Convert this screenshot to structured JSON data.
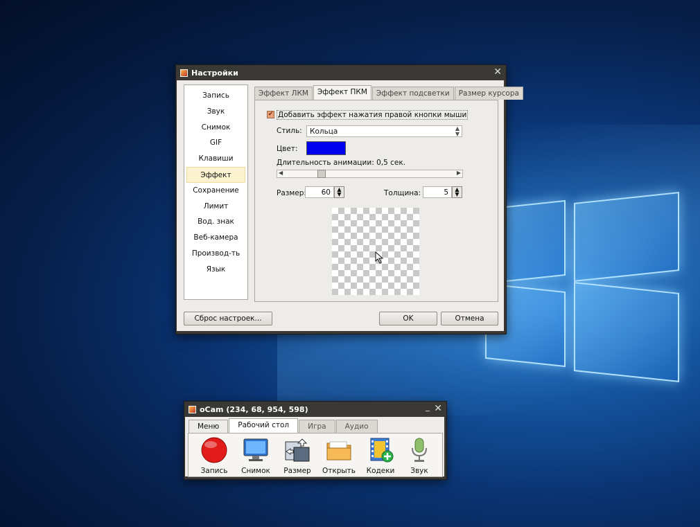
{
  "settings": {
    "title": "Настройки",
    "nav": [
      "Запись",
      "Звук",
      "Снимок",
      "GIF",
      "Клавиши",
      "Эффект",
      "Сохранение",
      "Лимит",
      "Вод. знак",
      "Веб-камера",
      "Производ-ть",
      "Язык"
    ],
    "active_nav": "Эффект",
    "tabs": [
      "Эффект ЛКМ",
      "Эффект ПКМ",
      "Эффект подсветки",
      "Размер курсора"
    ],
    "active_tab": "Эффект ПКМ",
    "enable_label": "Добавить эффект нажатия правой кнопки мыши",
    "enable_checked": true,
    "style_label": "Стиль:",
    "style_value": "Кольца",
    "color_label": "Цвет:",
    "color_value": "#0000ee",
    "duration_label": "Длительность анимации: 0,5 сек.",
    "duration_slider_fraction": 0.2,
    "size_label": "Размер:",
    "size_value": "60",
    "thickness_label": "Толщина:",
    "thickness_value": "5",
    "reset_button": "Сброс настроек...",
    "ok_button": "OK",
    "cancel_button": "Отмена"
  },
  "ocam": {
    "title": "oCam (234, 68, 954, 598)",
    "tabs": [
      "Меню",
      "Рабочий стол",
      "Игра",
      "Аудио"
    ],
    "active_tab": "Рабочий стол",
    "tools": [
      {
        "label": "Запись",
        "icon": "record-icon"
      },
      {
        "label": "Снимок",
        "icon": "monitor-icon"
      },
      {
        "label": "Размер",
        "icon": "resize-icon"
      },
      {
        "label": "Открыть",
        "icon": "folder-icon"
      },
      {
        "label": "Кодеки",
        "icon": "codec-film-icon"
      },
      {
        "label": "Звук",
        "icon": "microphone-icon"
      }
    ]
  }
}
